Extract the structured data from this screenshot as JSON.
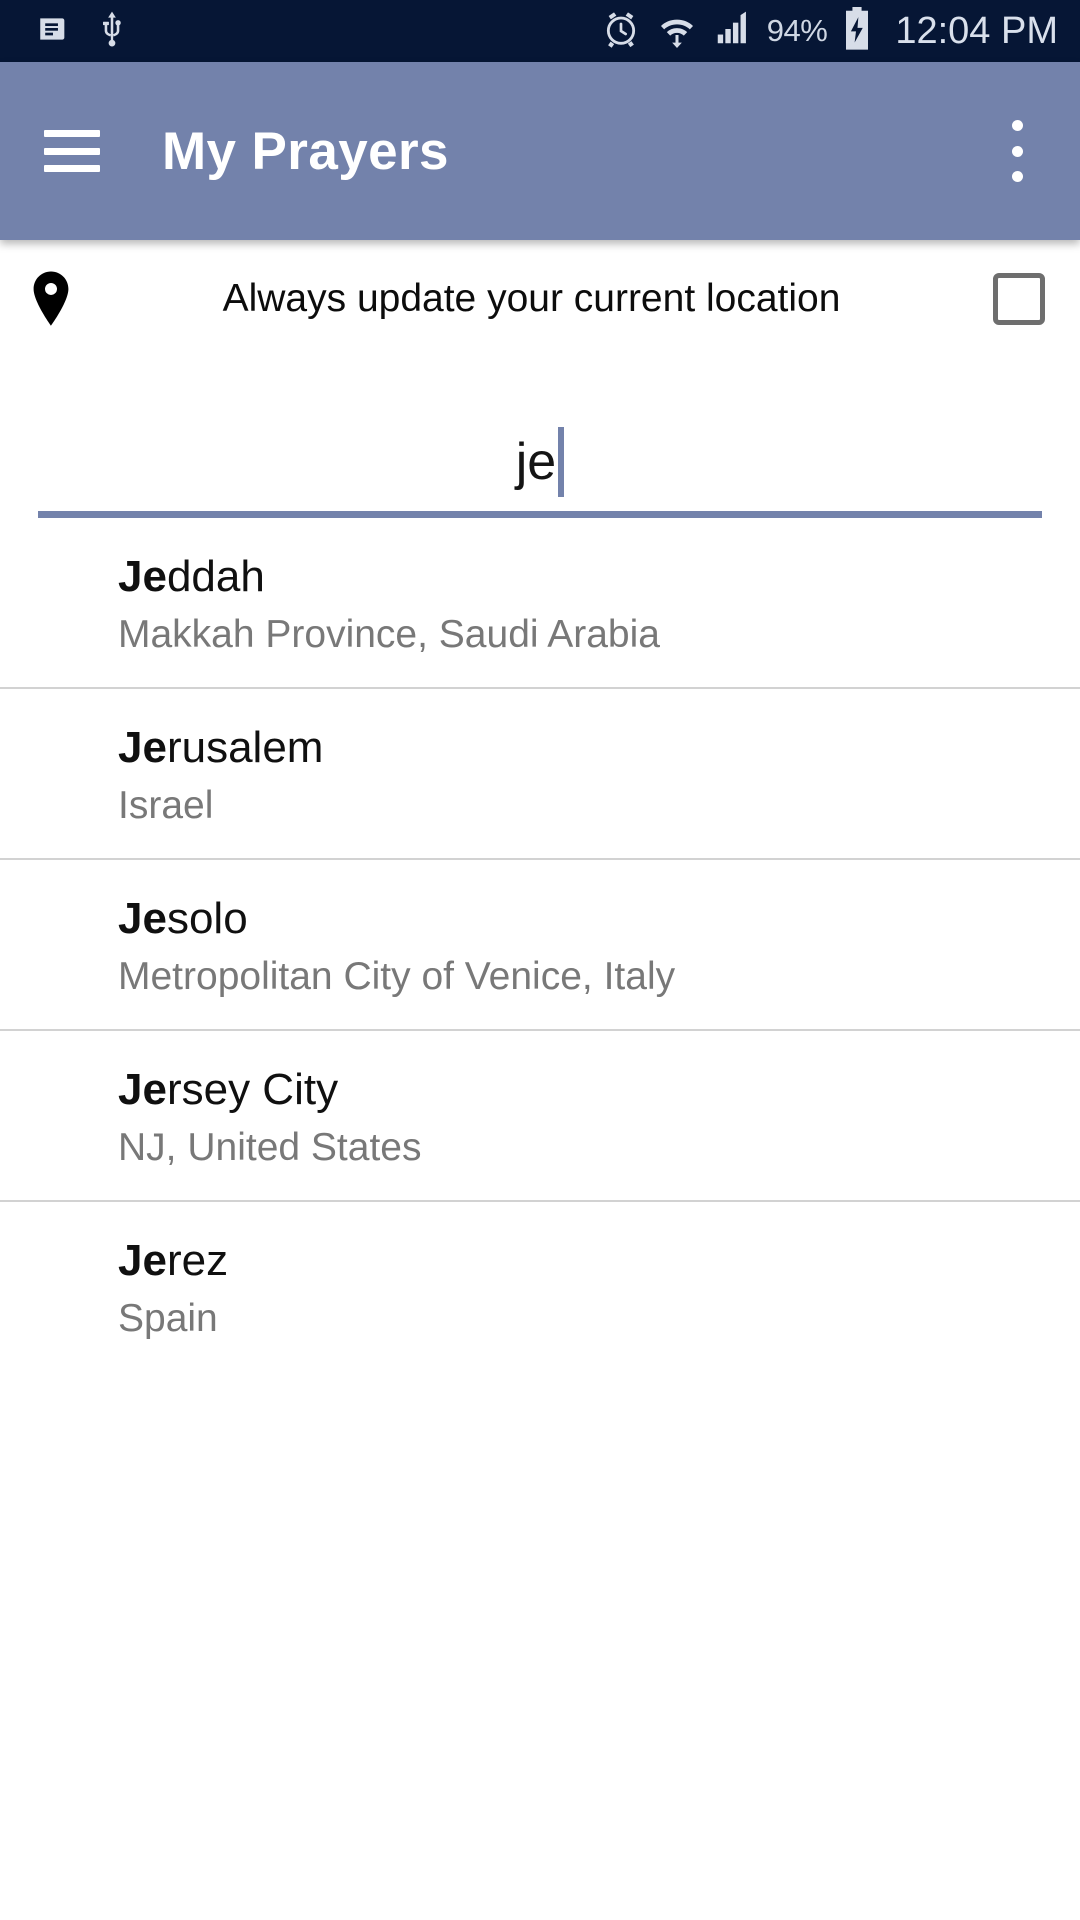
{
  "status_bar": {
    "icons_left": [
      "sms-message-icon",
      "usb-icon"
    ],
    "icons_right": [
      "alarm-clock-icon",
      "wifi-icon",
      "cellular-signal-icon",
      "battery-charging-icon"
    ],
    "battery_percent": "94%",
    "clock": "12:04 PM",
    "background_color": "#061635",
    "foreground_color": "#d7dde8"
  },
  "app_bar": {
    "menu_icon": "hamburger-menu-icon",
    "title": "My Prayers",
    "overflow_icon": "overflow-menu-icon",
    "background_color": "#7382ab",
    "title_color": "#ffffff"
  },
  "location_row": {
    "icon": "map-pin-icon",
    "label": "Always update your current location",
    "checkbox_checked": false,
    "checkbox_border_color": "#6e6e6e"
  },
  "search": {
    "value": "je",
    "placeholder": "",
    "underline_color": "#7382ab",
    "caret_color": "#7382ab"
  },
  "results": [
    {
      "match": "Je",
      "rest": "ddah",
      "subtitle": "Makkah Province, Saudi Arabia"
    },
    {
      "match": "Je",
      "rest": "rusalem",
      "subtitle": "Israel"
    },
    {
      "match": "Je",
      "rest": "solo",
      "subtitle": "Metropolitan City of Venice, Italy"
    },
    {
      "match": "Je",
      "rest": "rsey City",
      "subtitle": "NJ, United States"
    },
    {
      "match": "Je",
      "rest": "rez",
      "subtitle": "Spain"
    }
  ],
  "colors": {
    "accent": "#7382ab",
    "status_bar": "#061635",
    "divider": "#d2d2d2",
    "subtitle_text": "#787878",
    "title_text": "#101010"
  }
}
